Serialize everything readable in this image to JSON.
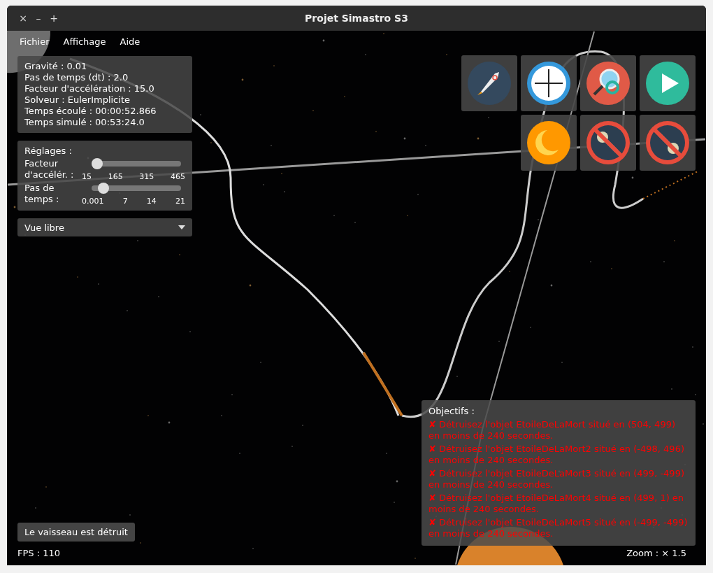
{
  "window": {
    "title": "Projet Simastro S3",
    "controls": [
      "×",
      "–",
      "+"
    ]
  },
  "menu": [
    "Fichier",
    "Affichage",
    "Aide"
  ],
  "info_panel": [
    "Gravité : 0.01",
    "Pas de temps (dt) : 2.0",
    "Facteur d'accélération : 15.0",
    "Solveur : EulerImplicite",
    "Temps écoulé : 00:00:52.866",
    "Temps simulé : 00:53:24.0"
  ],
  "settings": {
    "title": "Réglages :",
    "sliders": [
      {
        "label": "Facteur d'accélér. :",
        "level": 0,
        "ticks": [
          "15",
          "165",
          "315",
          "465"
        ]
      },
      {
        "label": "Pas de temps :",
        "level": 0.08,
        "ticks": [
          "0.001",
          "7",
          "14",
          "21"
        ]
      }
    ]
  },
  "view_select": {
    "value": "Vue libre"
  },
  "objectives": {
    "title": "Objectifs :",
    "items": [
      {
        "mark": "✘",
        "text": "Détruisez l'objet EtoileDeLaMort situé en (504, 499) en moins de 240 secondes.",
        "done": false
      },
      {
        "mark": "✘",
        "text": "Détruisez l'objet EtoileDeLaMort2 situé en (-498, 496) en moins de 240 secondes.",
        "done": false
      },
      {
        "mark": "✘",
        "text": "Détruisez l'objet EtoileDeLaMort3 situé en (499, -499) en moins de 240 secondes.",
        "done": false
      },
      {
        "mark": "✘",
        "text": "Détruisez l'objet EtoileDeLaMort4 situé en (499, 1) en moins de 240 secondes.",
        "done": false
      },
      {
        "mark": "✘",
        "text": "Détruisez l'objet EtoileDeLaMort5 situé en (-499, -499) en moins de 240 secondes.",
        "done": false
      }
    ]
  },
  "status_message": "Le vaisseau est détruit",
  "fps": "FPS : 110",
  "zoom": "Zoom : × 1.5"
}
